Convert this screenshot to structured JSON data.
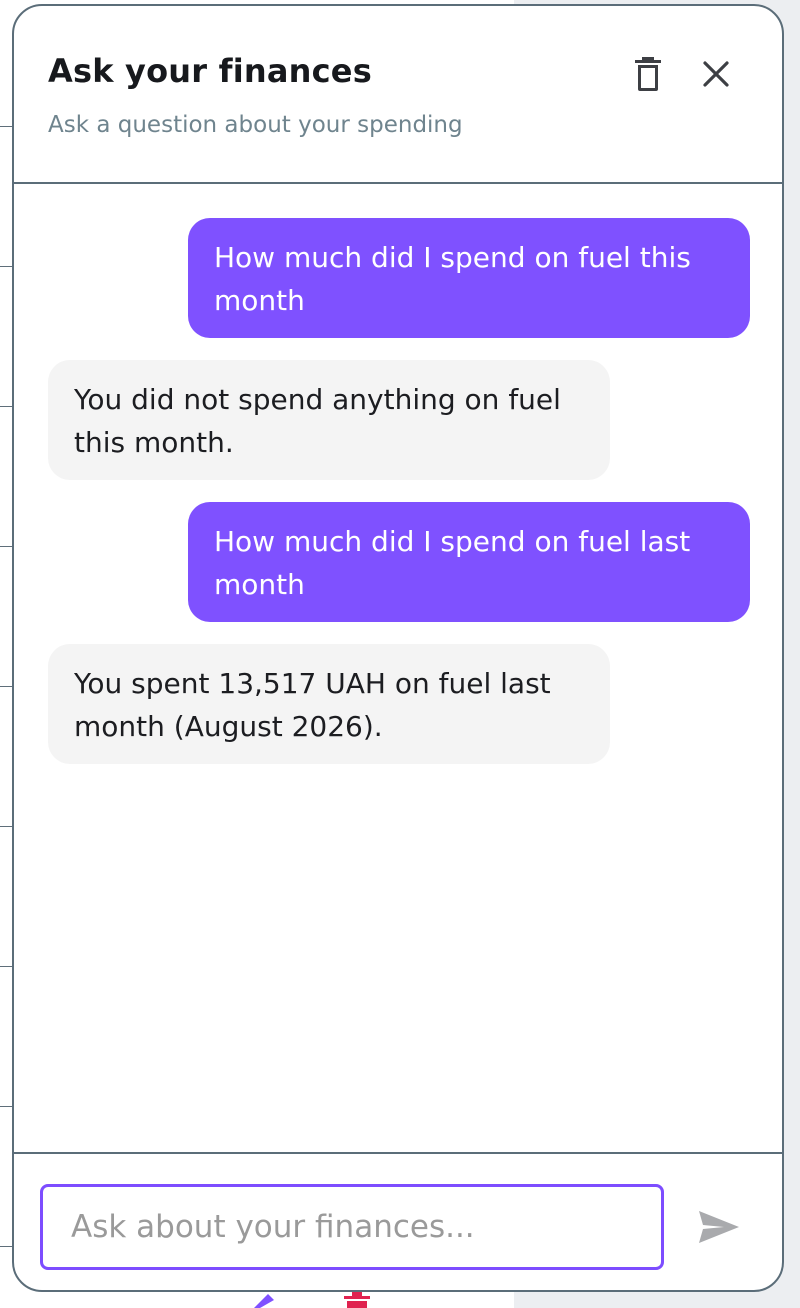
{
  "panel": {
    "title": "Ask your finances",
    "subtitle": "Ask a question about your spending"
  },
  "messages": [
    {
      "role": "user",
      "text": "How much did I spend on fuel this month"
    },
    {
      "role": "assistant",
      "text": "You did not spend anything on fuel this month."
    },
    {
      "role": "user",
      "text": "How much did I spend on fuel last month"
    },
    {
      "role": "assistant",
      "text": "You spent 13,517 UAH on fuel last month (August 2026)."
    }
  ],
  "composer": {
    "placeholder": "Ask about your finances...",
    "value": ""
  },
  "colors": {
    "accent": "#7f51ff",
    "bot_bubble": "#f4f4f4",
    "border": "#5b6d79",
    "subtitle": "#6f848e"
  },
  "icons": {
    "clear": "trash-icon",
    "close": "close-icon",
    "send": "send-icon"
  }
}
